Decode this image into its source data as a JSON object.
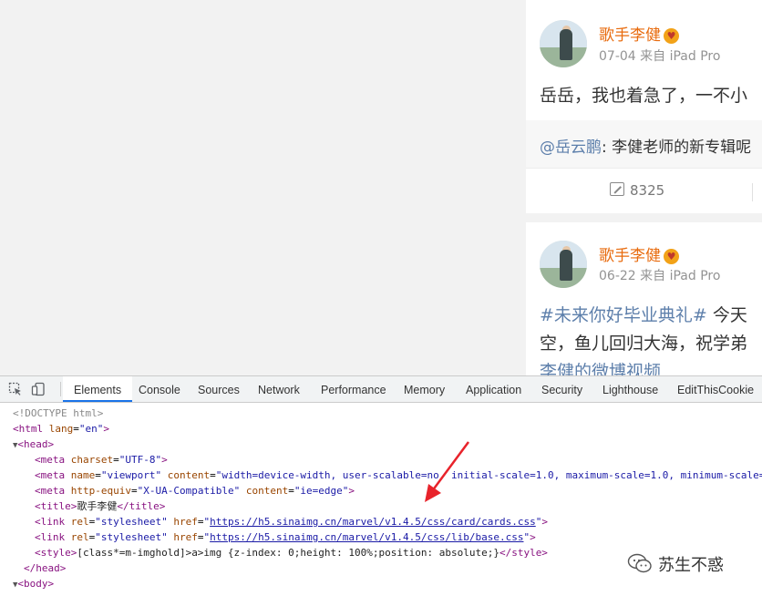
{
  "feed": {
    "posts": [
      {
        "author": "歌手李健",
        "meta": "07-04 来自 iPad Pro",
        "text": "岳岳，我也着急了，一不小",
        "retweet_user": "@岳云鹏",
        "retweet_text": ": 李健老师的新专辑呢",
        "repost_count": "8325"
      },
      {
        "author": "歌手李健",
        "meta": "06-22 来自 iPad Pro",
        "topic": "#未来你好毕业典礼#",
        "text_after_topic": " 今天",
        "line2": "空，鱼儿回归大海，祝学弟",
        "video_link": "李健的微博视频"
      }
    ]
  },
  "devtools": {
    "tabs": [
      "Elements",
      "Console",
      "Sources",
      "Network",
      "Performance",
      "Memory",
      "Application",
      "Security",
      "Lighthouse",
      "EditThisCookie"
    ],
    "active_tab": "Elements",
    "code": {
      "doctype": "<!DOCTYPE html>",
      "html_open": "<html",
      "lang_attr": "lang",
      "lang_val": "\"en\"",
      "head": "<head>",
      "meta1_attr": "charset",
      "meta1_val": "\"UTF-8\"",
      "meta2_name_val": "\"viewport\"",
      "meta2_content_val": "\"width=device-width, user-scalable=no, initial-scale=1.0, maximum-scale=1.0, minimum-scale=",
      "meta3_equiv_val": "\"X-UA-Compatible\"",
      "meta3_content_val": "\"ie=edge\"",
      "title_text": "歌手李健",
      "link1_href": "https://h5.sinaimg.cn/marvel/v1.4.5/css/card/cards.css",
      "link2_href": "https://h5.sinaimg.cn/marvel/v1.4.5/css/lib/base.css",
      "style_text": "[class*=m-imghold]>a>img {z-index: 0;height: 100%;position: absolute;}",
      "head_close": "</head>",
      "body_open": "<body>"
    }
  },
  "watermark": {
    "text": "苏生不惑"
  },
  "colors": {
    "author": "#e86b0e",
    "link_blue": "#5d7fab",
    "tab_active": "#1a73e8",
    "annotation_arrow": "#e8232b"
  }
}
